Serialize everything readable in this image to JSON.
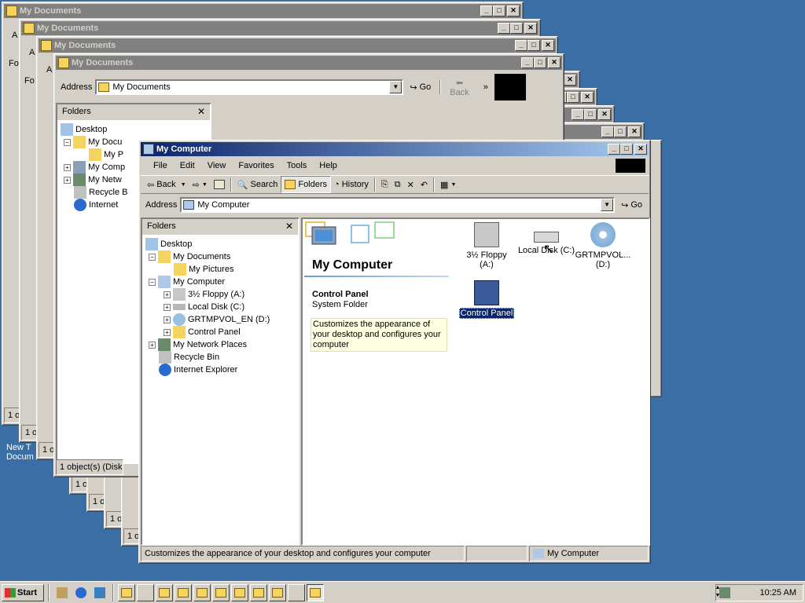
{
  "background_windows": {
    "title": "My Documents",
    "status_fragment": "1 ol",
    "status_full": "1 object(s) (Disk f",
    "address_label": "Address",
    "address_value": "My Documents",
    "go_label": "Go",
    "back_label": "Back",
    "folders_label": "Folders",
    "fo_fragment": "Fo",
    "a_fragment": "A",
    "tree": [
      "Desktop",
      "My Docu",
      "My P",
      "My Comp",
      "My Netw",
      "Recycle B",
      "Internet"
    ]
  },
  "desktop_icon": {
    "label_line1": "New T",
    "label_line2": "Docum"
  },
  "main_window": {
    "title": "My Computer",
    "menu": [
      "File",
      "Edit",
      "View",
      "Favorites",
      "Tools",
      "Help"
    ],
    "toolbar": {
      "back": "Back",
      "search": "Search",
      "folders": "Folders",
      "history": "History"
    },
    "address_label": "Address",
    "address_value": "My Computer",
    "go_label": "Go",
    "folders_pane": {
      "header": "Folders",
      "close": "✕",
      "tree": [
        {
          "label": "Desktop"
        },
        {
          "label": "My Documents"
        },
        {
          "label": "My Pictures"
        },
        {
          "label": "My Computer"
        },
        {
          "label": "3½ Floppy (A:)"
        },
        {
          "label": "Local Disk (C:)"
        },
        {
          "label": "GRTMPVOL_EN (D:)"
        },
        {
          "label": "Control Panel"
        },
        {
          "label": "My Network Places"
        },
        {
          "label": "Recycle Bin"
        },
        {
          "label": "Internet Explorer"
        }
      ]
    },
    "webview": {
      "heading": "My Computer",
      "item_title": "Control Panel",
      "item_type": "System Folder",
      "item_desc": "Customizes the appearance of your desktop and configures your computer"
    },
    "icons": [
      {
        "line1": "3½ Floppy",
        "line2": "(A:)"
      },
      {
        "line1": "Local Disk (C:)",
        "line2": ""
      },
      {
        "line1": "GRTMPVOL...",
        "line2": "(D:)"
      },
      {
        "line1": "Control Panel",
        "line2": ""
      }
    ],
    "status": {
      "text": "Customizes the appearance of your desktop and configures your computer",
      "zone": "My Computer"
    }
  },
  "taskbar": {
    "start": "Start",
    "clock": "10:25 AM"
  },
  "colors": {
    "desktop": "#3a6ea5",
    "title_active": "#0a246a",
    "face": "#d4d0c8"
  }
}
